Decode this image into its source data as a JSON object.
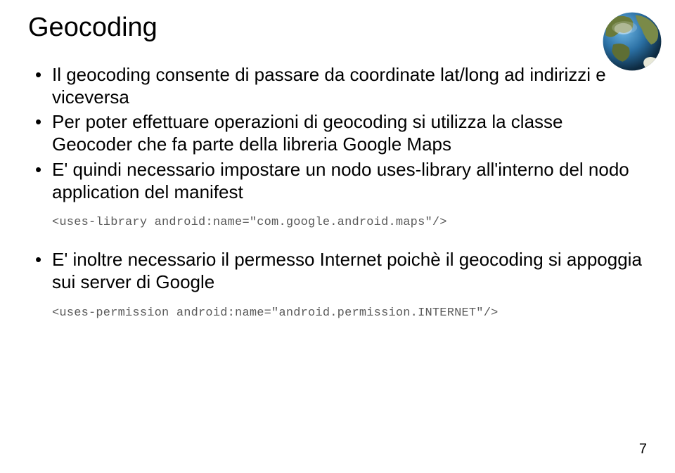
{
  "title": "Geocoding",
  "bullets": {
    "b1": "Il geocoding consente di passare da coordinate lat/long ad indirizzi e viceversa",
    "b2": "Per poter effettuare operazioni di geocoding si utilizza la classe Geocoder che fa parte della libreria Google Maps",
    "b3": "E' quindi necessario impostare un nodo uses-library all'interno del nodo application del manifest",
    "b4": "E' inoltre necessario il permesso Internet poichè il geocoding si appoggia sui server di Google"
  },
  "code": {
    "c1": "<uses-library android:name=\"com.google.android.maps\"/>",
    "c2": "<uses-permission android:name=\"android.permission.INTERNET\"/>"
  },
  "page_number": "7"
}
